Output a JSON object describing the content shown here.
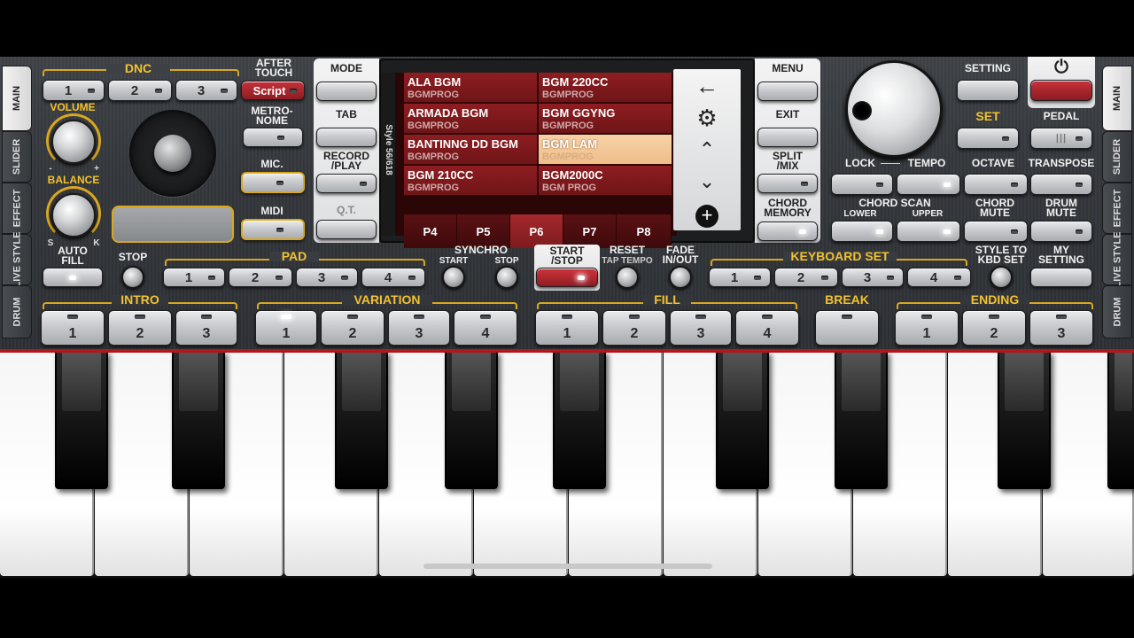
{
  "side_tabs_left": [
    "MAIN",
    "SLIDER",
    "EFFECT",
    "LIVE STYLE",
    "DRUM"
  ],
  "side_tabs_right": [
    "MAIN",
    "SLIDER",
    "EFFECT",
    "LIVE STYLE",
    "DRUM"
  ],
  "dnc": {
    "label": "DNC",
    "buttons": [
      "1",
      "2",
      "3"
    ],
    "after_touch": "AFTER\nTOUCH",
    "script": "Script"
  },
  "volume_label": "VOLUME",
  "balance_label": "BALANCE",
  "balance_minus": "-",
  "balance_plus": "+",
  "balance_s": "S",
  "balance_k": "K",
  "auto_fill": "AUTO\nFILL",
  "metronome": "METRO-\nNOME",
  "mic": "MIC.",
  "midi": "MIDI",
  "left_col": [
    "MODE",
    "TAB",
    "RECORD\n/PLAY",
    "Q.T."
  ],
  "right_col": [
    "MENU",
    "EXIT",
    "SPLIT\n/MIX",
    "CHORD\nMEMORY"
  ],
  "screen": {
    "side_label": "Style 56/618",
    "styles": [
      {
        "name": "ALA BGM",
        "sub": "BGMPROG"
      },
      {
        "name": "BGM 220CC",
        "sub": "BGMPROG"
      },
      {
        "name": "ARMADA BGM",
        "sub": "BGMPROG"
      },
      {
        "name": "BGM GGYNG",
        "sub": "BGMPROG"
      },
      {
        "name": "BANTINNG DD BGM",
        "sub": "BGMPROG"
      },
      {
        "name": "BGM LAM",
        "sub": "BGMPROG"
      },
      {
        "name": "BGM 210CC",
        "sub": "BGMPROG"
      },
      {
        "name": "BGM2000C",
        "sub": "BGM PROG"
      }
    ],
    "pages": [
      "P4",
      "P5",
      "P6",
      "P7",
      "P8"
    ],
    "active_page": "P6"
  },
  "right_panel": {
    "setting": "SETTING",
    "set": "SET",
    "pedal": "PEDAL",
    "lock": "LOCK",
    "tempo": "TEMPO",
    "octave": "OCTAVE",
    "transpose": "TRANSPOSE",
    "chord_scan": "CHORD SCAN",
    "lower": "LOWER",
    "upper": "UPPER",
    "chord_mute": "CHORD\nMUTE",
    "drum_mute": "DRUM\nMUTE",
    "power_icon": "⏻"
  },
  "pad": {
    "stop": "STOP",
    "label": "PAD",
    "buttons": [
      "1",
      "2",
      "3",
      "4"
    ]
  },
  "synchro": {
    "label": "SYNCHRO",
    "start": "START",
    "stop": "STOP"
  },
  "start_stop": "START\n/STOP",
  "reset": "RESET",
  "tap_tempo": "TAP TEMPO",
  "fade": "FADE\nIN/OUT",
  "keyboard_set": {
    "label": "KEYBOARD SET",
    "buttons": [
      "1",
      "2",
      "3",
      "4"
    ]
  },
  "style_to_kbd": "STYLE TO\nKBD SET",
  "my_setting": "MY\nSETTING",
  "intro": {
    "label": "INTRO",
    "buttons": [
      "1",
      "2",
      "3"
    ]
  },
  "variation": {
    "label": "VARIATION",
    "buttons": [
      "1",
      "2",
      "3",
      "4"
    ]
  },
  "fill": {
    "label": "FILL",
    "buttons": [
      "1",
      "2",
      "3",
      "4"
    ]
  },
  "break_label": "BREAK",
  "ending": {
    "label": "ENDING",
    "buttons": [
      "1",
      "2",
      "3"
    ]
  },
  "colors": {
    "accent_gold": "#f2c230",
    "screen_red": "#8e1d21",
    "selected": "#f7d2a6",
    "active_red": "#b01820"
  }
}
